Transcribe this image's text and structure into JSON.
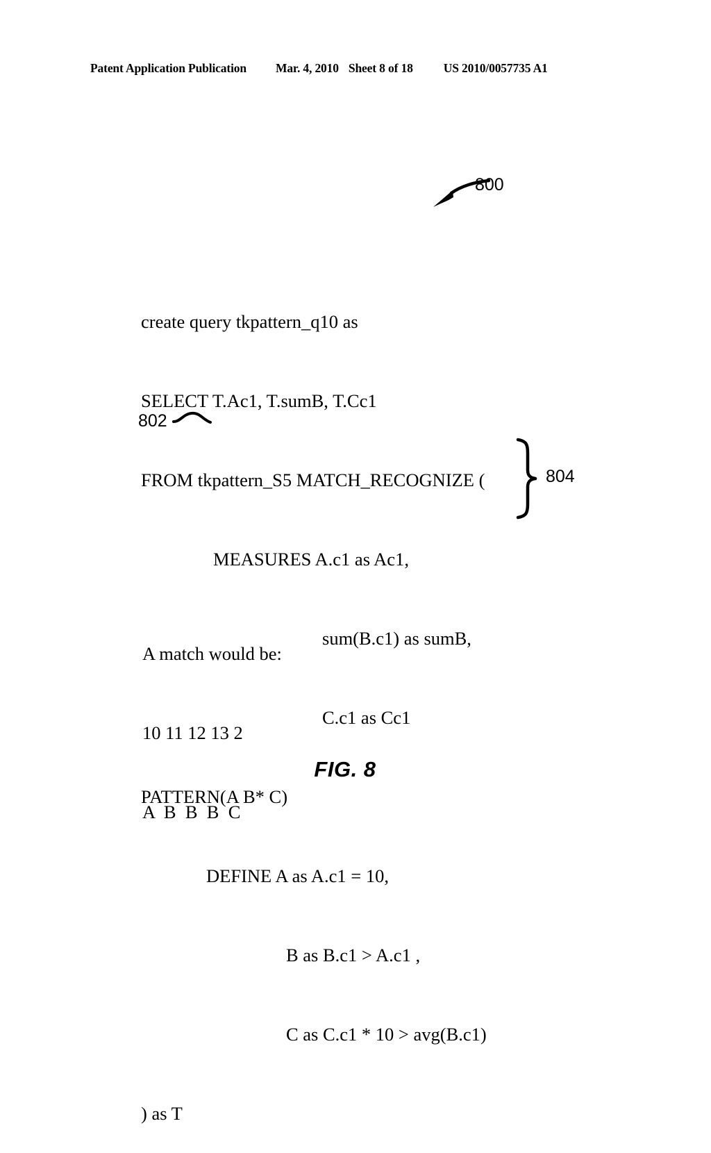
{
  "header": {
    "publication": "Patent Application Publication",
    "date": "Mar. 4, 2010",
    "sheet": "Sheet 8 of 18",
    "patent_number": "US 2010/0057735 A1"
  },
  "figure": {
    "caption": "FIG. 8",
    "reference_800": "800",
    "reference_802": "802",
    "reference_804": "804"
  },
  "code": {
    "lines": [
      "create query tkpattern_q10 as",
      "SELECT T.Ac1, T.sumB, T.Cc1",
      "FROM tkpattern_S5 MATCH_RECOGNIZE (",
      "MEASURES A.c1 as Ac1,",
      "sum(B.c1) as sumB,",
      "C.c1 as Cc1",
      "PATTERN(A B* C)",
      "DEFINE A as A.c1 = 10,",
      "B as B.c1 > A.c1 ,",
      "C as C.c1 * 10 > avg(B.c1)",
      ") as T"
    ]
  },
  "match_example": {
    "lines": [
      "A match would be:",
      "10 11 12 13 2",
      "A  B  B  B  C"
    ]
  },
  "colors": {
    "ink": "#000000",
    "paper": "#ffffff"
  }
}
